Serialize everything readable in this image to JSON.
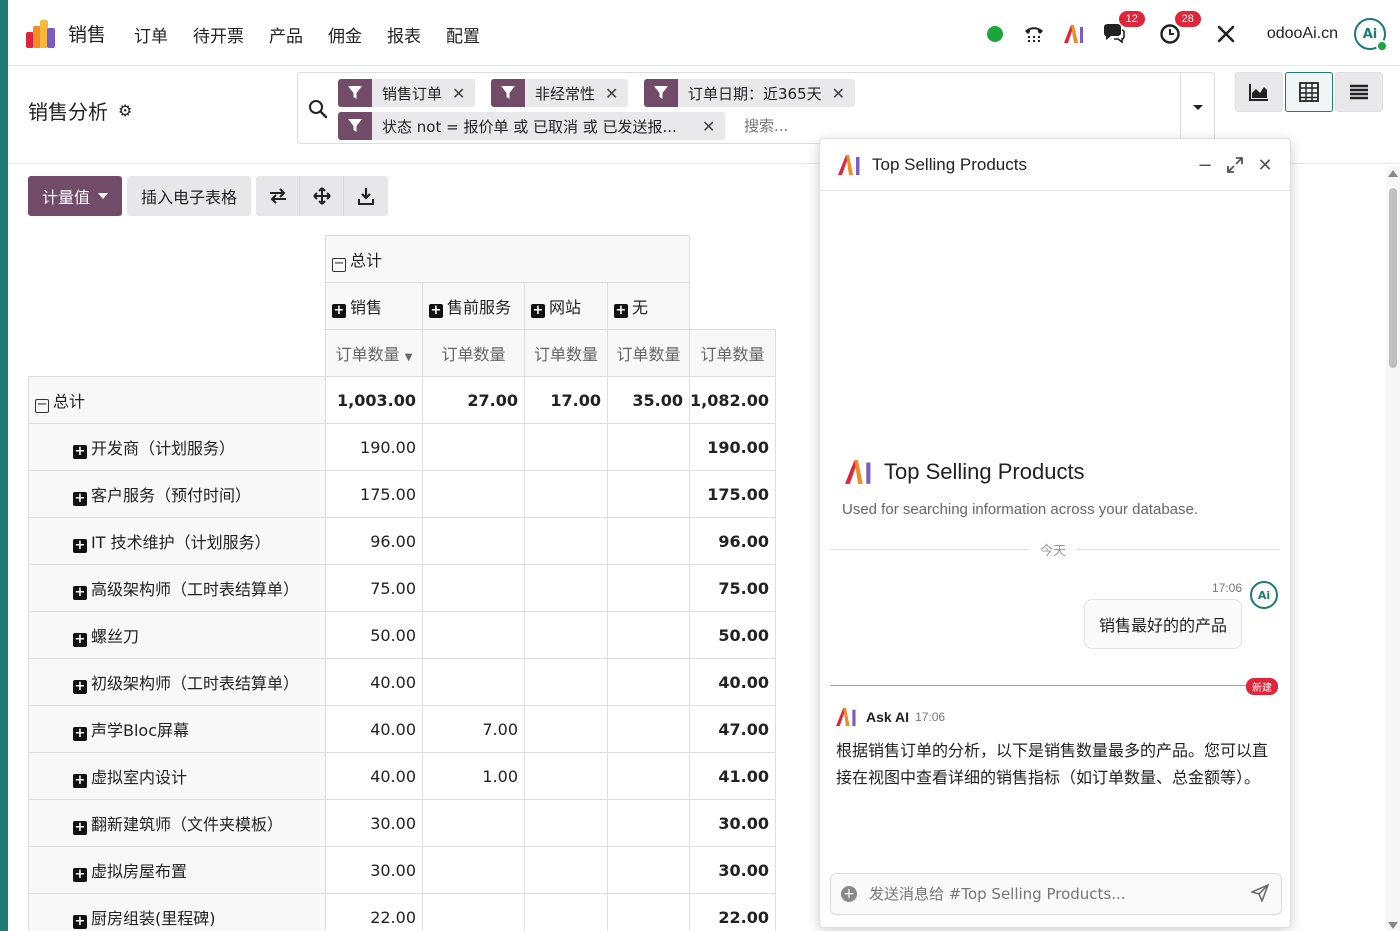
{
  "nav": {
    "app_name": "销售",
    "menu": [
      "订单",
      "待开票",
      "产品",
      "佣金",
      "报表",
      "配置"
    ],
    "company": "odooAi.cn",
    "avatar_text": "Ai",
    "messages_badge": "12",
    "activities_badge": "28"
  },
  "control": {
    "title": "销售分析",
    "facets": [
      {
        "label": "销售订单"
      },
      {
        "label": "非经常性"
      },
      {
        "label": "订单日期：近365天"
      },
      {
        "label": "状态 not = 报价单 或 已取消 或 已发送报..."
      }
    ],
    "search_placeholder": "搜索..."
  },
  "toolbar": {
    "measures_label": "计量值",
    "insert_sheet_label": "插入电子表格"
  },
  "pivot": {
    "col_total_label": "总计",
    "col_groups": [
      "销售",
      "售前服务",
      "网站",
      "无"
    ],
    "measure_label": "订单数量",
    "row_total": {
      "label": "总计",
      "values": [
        "1,003.00",
        "27.00",
        "17.00",
        "35.00",
        "1,082.00"
      ]
    },
    "rows": [
      {
        "label": "开发商（计划服务）",
        "values": [
          "190.00",
          "",
          "",
          "",
          "190.00"
        ]
      },
      {
        "label": "客户服务（预付时间）",
        "values": [
          "175.00",
          "",
          "",
          "",
          "175.00"
        ]
      },
      {
        "label": "IT 技术维护（计划服务）",
        "values": [
          "96.00",
          "",
          "",
          "",
          "96.00"
        ]
      },
      {
        "label": "高级架构师（工时表结算单）",
        "values": [
          "75.00",
          "",
          "",
          "",
          "75.00"
        ]
      },
      {
        "label": "螺丝刀",
        "values": [
          "50.00",
          "",
          "",
          "",
          "50.00"
        ]
      },
      {
        "label": "初级架构师（工时表结算单）",
        "values": [
          "40.00",
          "",
          "",
          "",
          "40.00"
        ]
      },
      {
        "label": "声学Bloc屏幕",
        "values": [
          "40.00",
          "7.00",
          "",
          "",
          "47.00"
        ]
      },
      {
        "label": "虚拟室内设计",
        "values": [
          "40.00",
          "1.00",
          "",
          "",
          "41.00"
        ]
      },
      {
        "label": "翻新建筑师（文件夹模板）",
        "values": [
          "30.00",
          "",
          "",
          "",
          "30.00"
        ]
      },
      {
        "label": "虚拟房屋布置",
        "values": [
          "30.00",
          "",
          "",
          "",
          "30.00"
        ]
      },
      {
        "label": "厨房组装(里程碑)",
        "values": [
          "22.00",
          "",
          "",
          "",
          "22.00"
        ]
      }
    ]
  },
  "ai": {
    "header_title": "Top Selling Products",
    "intro_title": "Top Selling Products",
    "intro_desc": "Used for searching information across your database.",
    "today_label": "今天",
    "user_time": "17:06",
    "user_avatar": "Ai",
    "user_message": "销售最好的的产品",
    "new_label": "新建",
    "bot_name": "Ask AI",
    "bot_time": "17:06",
    "bot_message": "根据销售订单的分析，以下是销售数量最多的产品。您可以直接在视图中查看详细的销售指标（如订单数量、总金额等）。",
    "composer_placeholder": "发送消息给 #Top Selling Products..."
  },
  "colors": {
    "brand": "#714b67",
    "accent": "#1d7a74",
    "badge": "#e0243a",
    "online": "#1aa639"
  }
}
